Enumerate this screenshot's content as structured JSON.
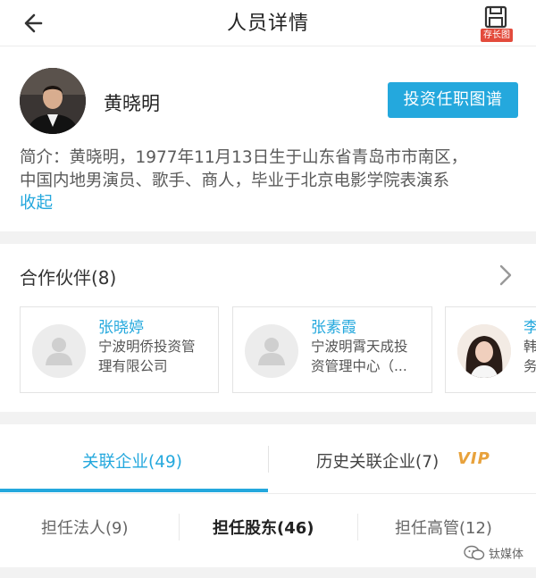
{
  "header": {
    "title": "人员详情",
    "back_icon": "back-arrow-icon",
    "save_icon": "save-disk-icon",
    "save_badge": "存长图"
  },
  "profile": {
    "name": "黄晓明",
    "graph_button": "投资任职图谱",
    "intro_line1": "简介：黄晓明，1977年11月13日生于山东省青岛市市南区，",
    "intro_line2": "中国内地男演员、歌手、商人，毕业于北京电影学院表演系",
    "collapse": "收起"
  },
  "partners": {
    "title": "合作伙伴(8)",
    "items": [
      {
        "name": "张晓婷",
        "company_line1": "宁波明侨投资管",
        "company_line2": "理有限公司"
      },
      {
        "name": "张素霞",
        "company_line1": "宁波明霄天成投",
        "company_line2": "资管理中心（..."
      },
      {
        "name": "李",
        "company_line1": "韩",
        "company_line2": "务"
      }
    ]
  },
  "tabs": {
    "related": "关联企业(49)",
    "history": "历史关联企业(7)",
    "vip": "VIP"
  },
  "subtabs": {
    "legal": "担任法人(9)",
    "shareholder": "担任股东(46)",
    "executive": "担任高管(12)"
  },
  "watermark": "钛媒体",
  "colors": {
    "accent": "#24a8dd",
    "vip": "#e8a23c",
    "badge": "#e34b3c"
  }
}
